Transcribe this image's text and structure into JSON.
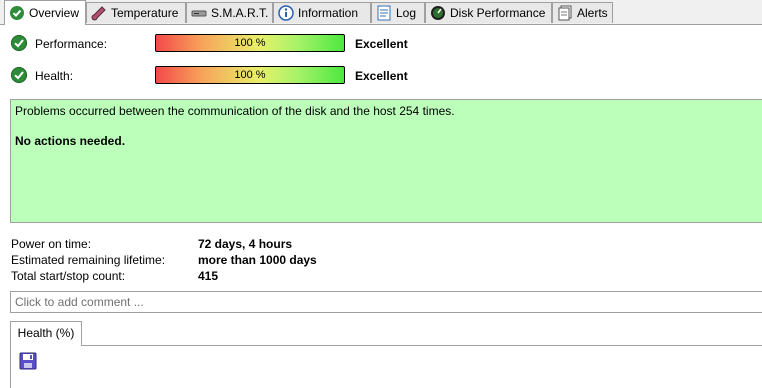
{
  "tabs": [
    {
      "label": "Overview",
      "icon": "green-check-icon",
      "active": true
    },
    {
      "label": "Temperature",
      "icon": "thermometer-icon"
    },
    {
      "label": "S.M.A.R.T.",
      "icon": "drive-icon"
    },
    {
      "label": "Information",
      "icon": "info-icon"
    },
    {
      "label": "Log",
      "icon": "log-document-icon"
    },
    {
      "label": "Disk Performance",
      "icon": "gauge-icon"
    },
    {
      "label": "Alerts",
      "icon": "alerts-document-icon"
    }
  ],
  "performance": {
    "label": "Performance:",
    "value_text": "100 %",
    "level_percent": 100,
    "verdict": "Excellent"
  },
  "health": {
    "label": "Health:",
    "value_text": "100 %",
    "level_percent": 100,
    "verdict": "Excellent"
  },
  "message": {
    "line1": "Problems occurred between the communication of the disk and the host 254 times.",
    "line2": "No actions needed.",
    "background": "#bbffbb"
  },
  "info": {
    "power_on_label": "Power on time:",
    "power_on_value": "72 days, 4 hours",
    "lifetime_label": "Estimated remaining lifetime:",
    "lifetime_value": "more than 1000 days",
    "startstop_label": "Total start/stop count:",
    "startstop_value": "415"
  },
  "comment": {
    "placeholder": "Click to add comment ..."
  },
  "health_tab": {
    "label": "Health (%)"
  },
  "colors": {
    "ok_green": "#2e8b3a",
    "bar_low": "#f44a4a",
    "bar_high": "#4ce840"
  }
}
